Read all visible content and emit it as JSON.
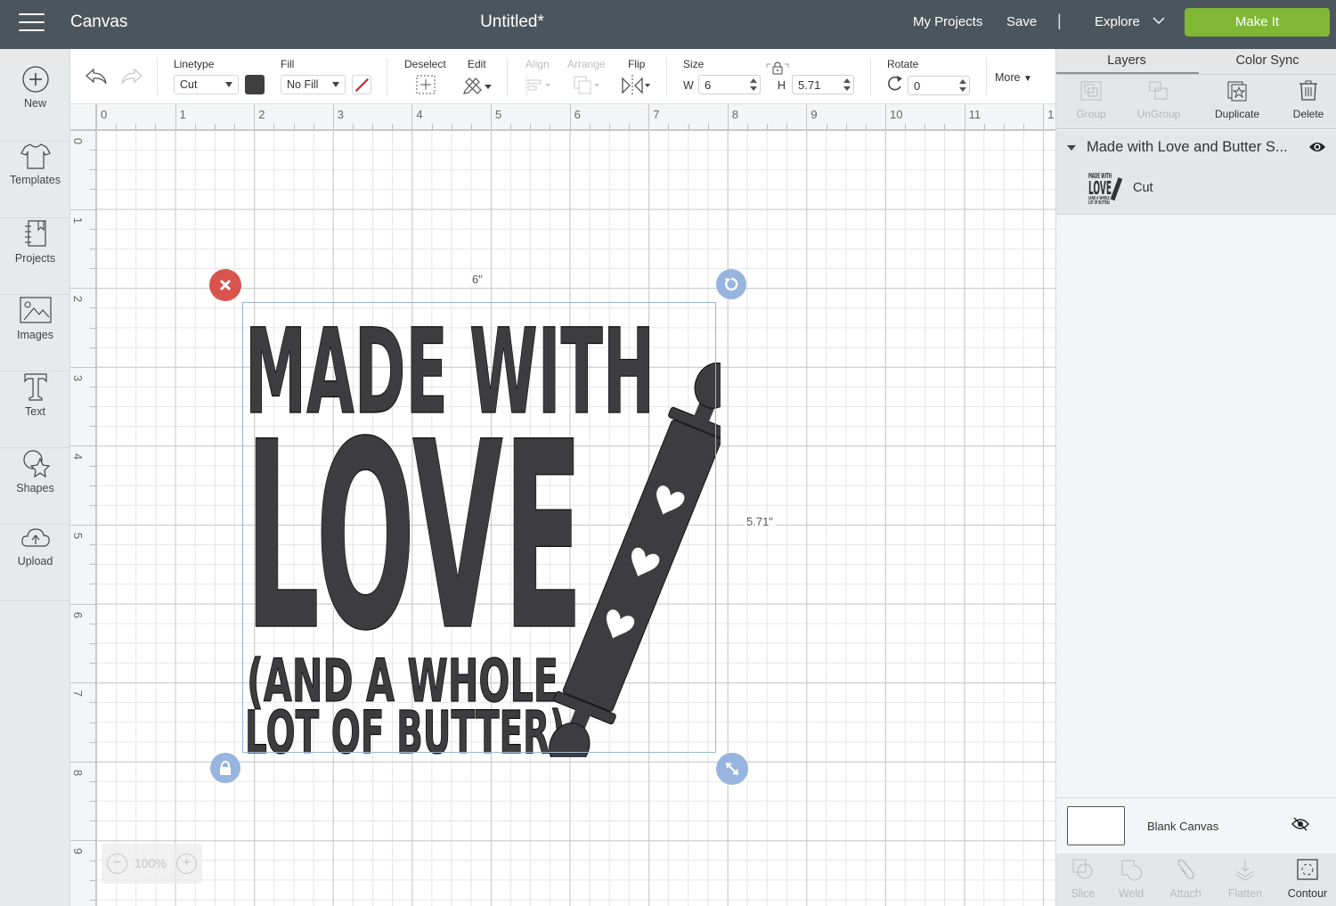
{
  "header": {
    "app_title": "Canvas",
    "doc_title": "Untitled*",
    "my_projects": "My Projects",
    "save": "Save",
    "separator": "|",
    "explore": "Explore",
    "make_it": "Make It",
    "make_it_color": "#80b836",
    "bg_color": "#4b555d"
  },
  "sidebar": {
    "items": [
      {
        "label": "New",
        "icon": "plus-circle-icon"
      },
      {
        "label": "Templates",
        "icon": "tshirt-icon"
      },
      {
        "label": "Projects",
        "icon": "notebook-icon"
      },
      {
        "label": "Images",
        "icon": "image-icon"
      },
      {
        "label": "Text",
        "icon": "text-t-icon"
      },
      {
        "label": "Shapes",
        "icon": "shapes-icon"
      },
      {
        "label": "Upload",
        "icon": "cloud-upload-icon"
      }
    ]
  },
  "toolbar": {
    "linetype_label": "Linetype",
    "linetype_value": "Cut",
    "linetype_color": "#3f3f3f",
    "fill_label": "Fill",
    "fill_value": "No Fill",
    "deselect_label": "Deselect",
    "edit_label": "Edit",
    "align_label": "Align",
    "arrange_label": "Arrange",
    "flip_label": "Flip",
    "size_label": "Size",
    "w_label": "W",
    "w_value": "6",
    "h_label": "H",
    "h_value": "5.71",
    "rotate_label": "Rotate",
    "rotate_value": "0",
    "more_label": "More"
  },
  "canvas": {
    "ruler_h": [
      "0",
      "1",
      "2",
      "3",
      "4",
      "5",
      "6",
      "7",
      "8",
      "9",
      "10",
      "11",
      "1"
    ],
    "ruler_v": [
      "0",
      "1",
      "2",
      "3",
      "4",
      "5",
      "6",
      "7",
      "8",
      "9"
    ],
    "width_dim": "6\"",
    "height_dim": "5.71\"",
    "zoom_value": "100%",
    "zoom_out": "−",
    "zoom_in": "+",
    "design": {
      "line1": "MADE WITH",
      "line2": "LOVE",
      "line3": "(AND A WHOLE",
      "line4": "LOT OF BUTTER)",
      "color": "#3d3d3f"
    }
  },
  "right_panel": {
    "tabs": [
      "Layers",
      "Color Sync"
    ],
    "active_tab": "Layers",
    "tools": [
      {
        "label": "Group",
        "enabled": false
      },
      {
        "label": "UnGroup",
        "enabled": false
      },
      {
        "label": "Duplicate",
        "enabled": true
      },
      {
        "label": "Delete",
        "enabled": true
      }
    ],
    "layer_group_title": "Made with Love and Butter S...",
    "layer_item_name": "Cut",
    "blank_canvas": "Blank Canvas",
    "bottom_tools": [
      {
        "label": "Slice",
        "enabled": false
      },
      {
        "label": "Weld",
        "enabled": false
      },
      {
        "label": "Attach",
        "enabled": false
      },
      {
        "label": "Flatten",
        "enabled": false
      },
      {
        "label": "Contour",
        "enabled": true
      }
    ]
  }
}
